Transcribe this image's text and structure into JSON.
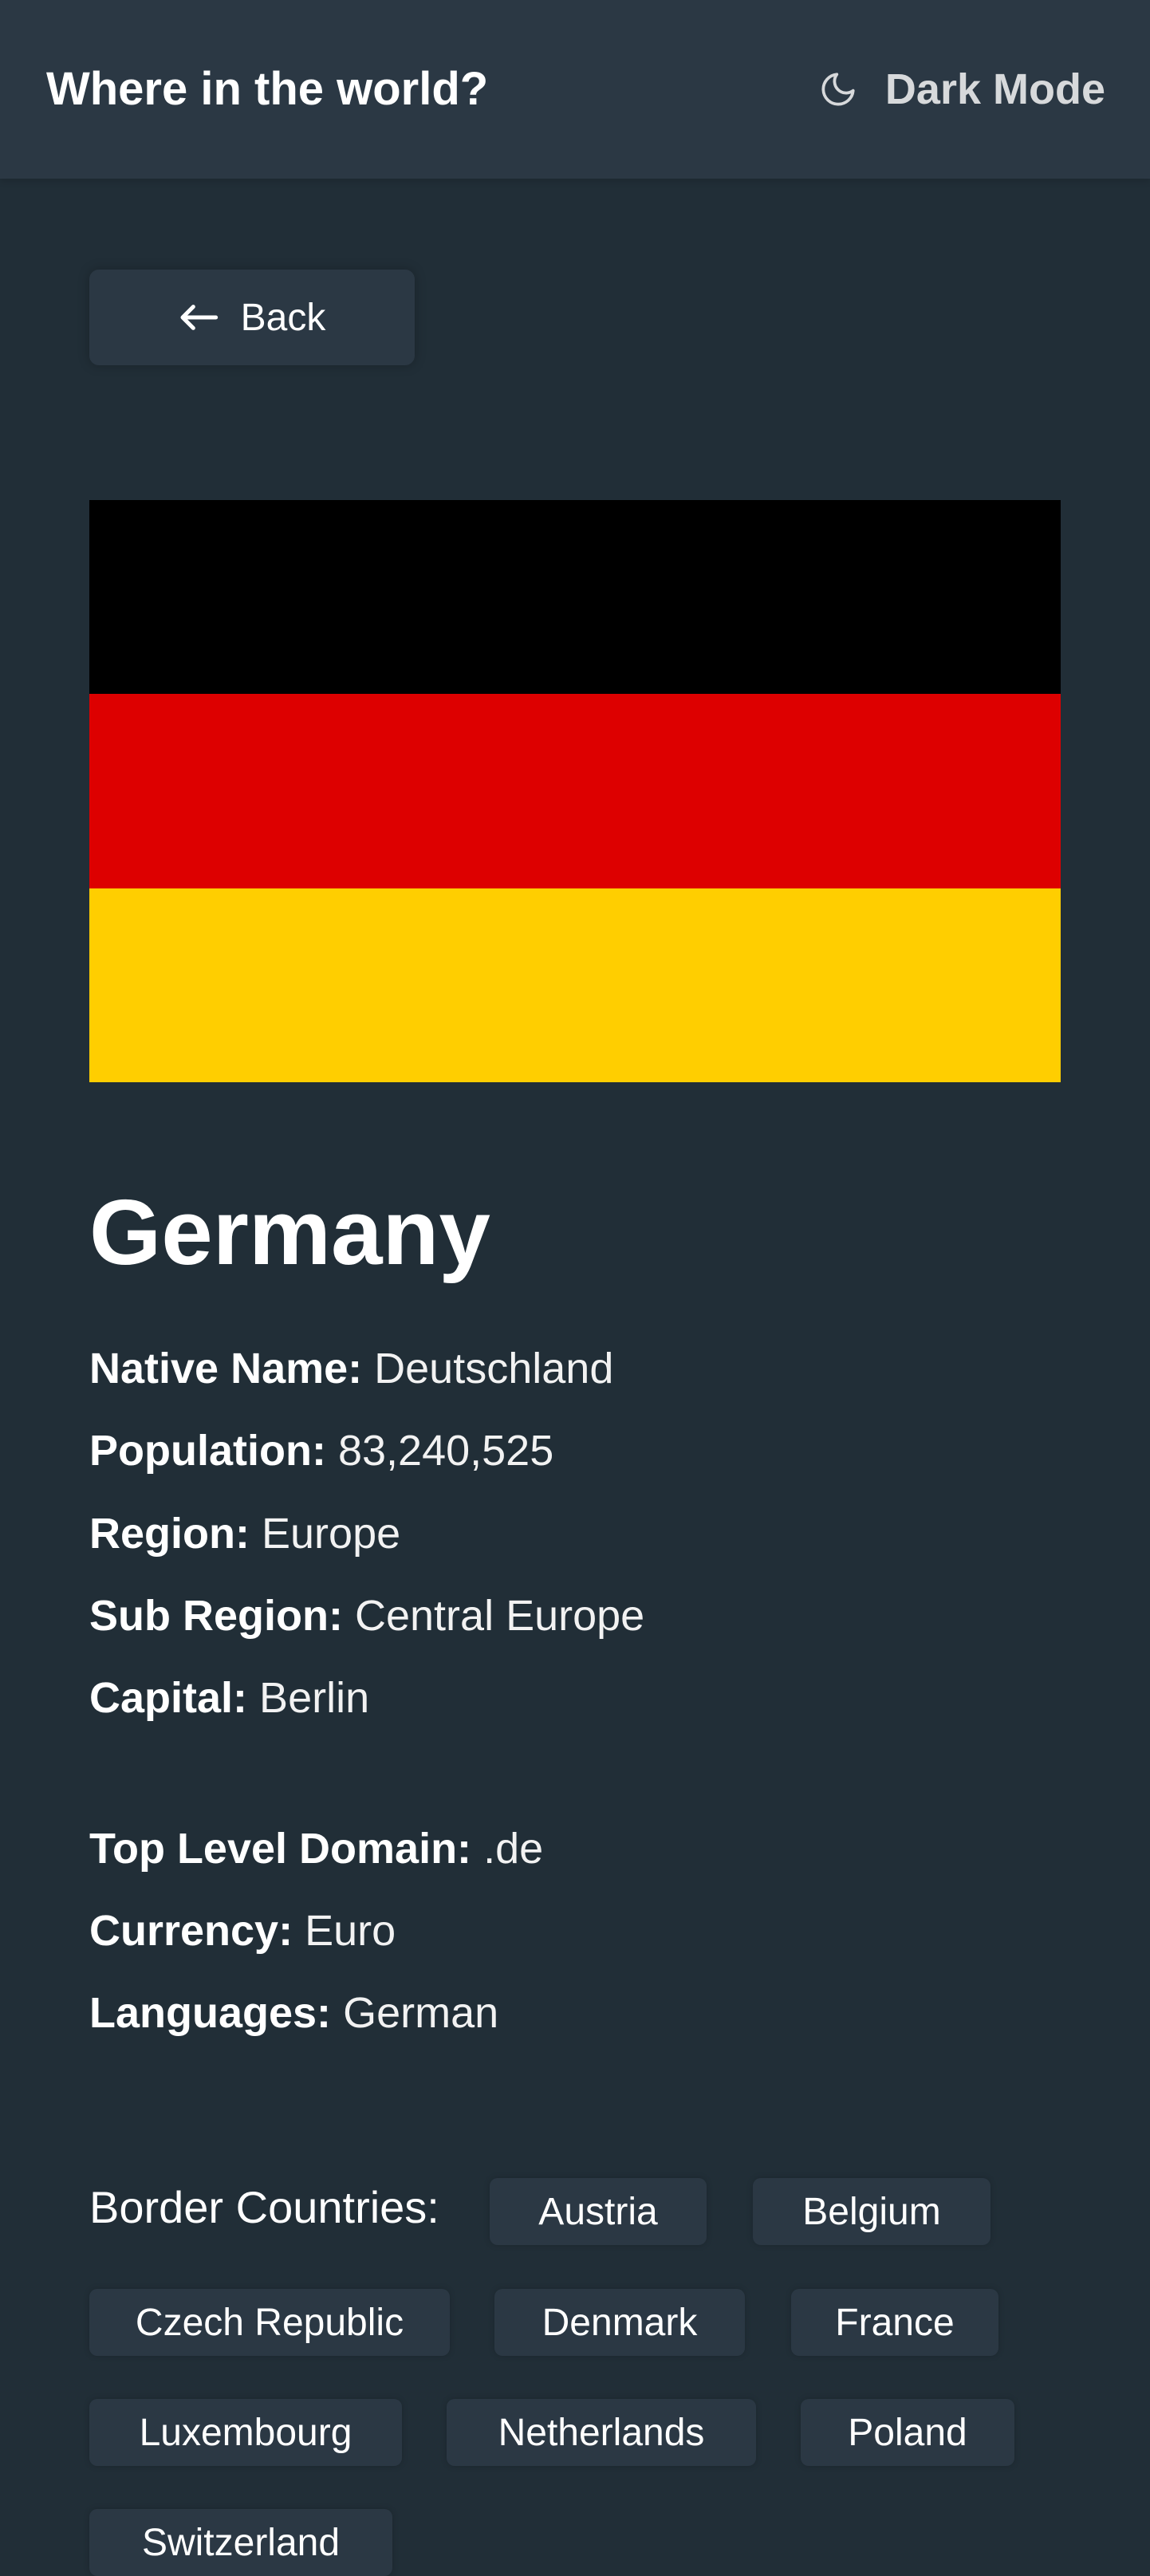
{
  "header": {
    "title": "Where in the world?",
    "mode_toggle": {
      "label": "Dark Mode",
      "icon": "moon-icon"
    }
  },
  "back_button": {
    "label": "Back",
    "icon": "arrow-left-icon"
  },
  "flag": {
    "colors": [
      "#000000",
      "#DD0000",
      "#FFCE00"
    ]
  },
  "country": {
    "name": "Germany",
    "native_name": {
      "label": "Native Name:",
      "value": "Deutschland"
    },
    "population": {
      "label": "Population:",
      "value": "83,240,525"
    },
    "region": {
      "label": "Region:",
      "value": "Europe"
    },
    "sub_region": {
      "label": "Sub Region:",
      "value": "Central Europe"
    },
    "capital": {
      "label": "Capital:",
      "value": "Berlin"
    },
    "top_level_domain": {
      "label": "Top Level Domain:",
      "value": ".de"
    },
    "currency": {
      "label": "Currency:",
      "value": "Euro"
    },
    "languages": {
      "label": "Languages:",
      "value": "German"
    }
  },
  "border_countries": {
    "label": "Border Countries:",
    "items": [
      "Austria",
      "Belgium",
      "Czech Republic",
      "Denmark",
      "France",
      "Luxembourg",
      "Netherlands",
      "Poland",
      "Switzerland"
    ]
  }
}
